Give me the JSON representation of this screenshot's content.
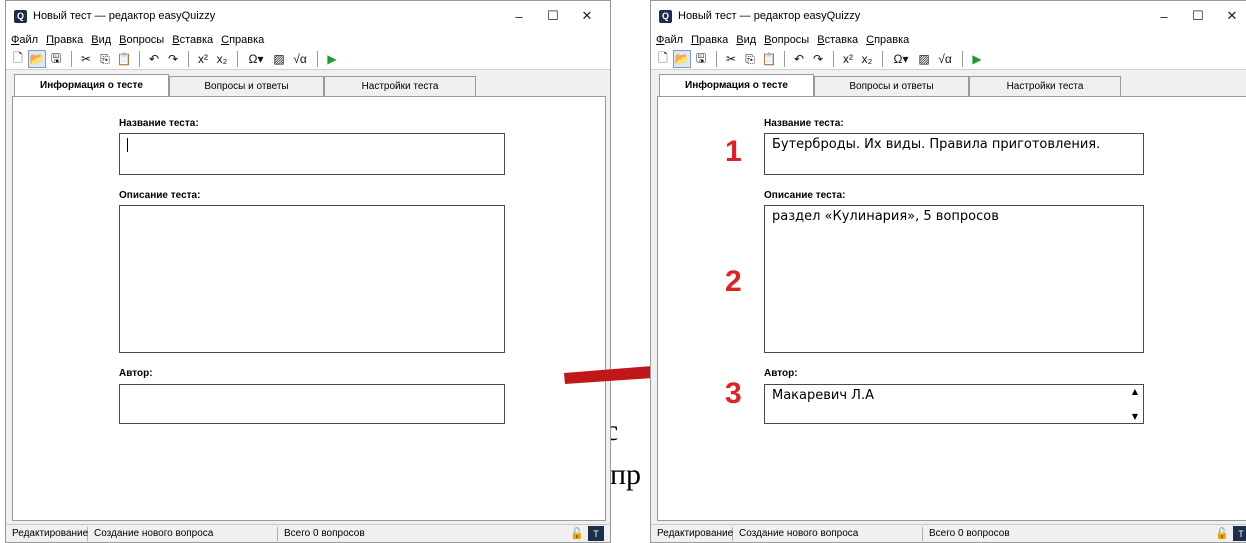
{
  "window": {
    "title": "Новый тест — редактор easyQuizzy",
    "icon_letter": "Q"
  },
  "window_controls": {
    "minimize": "–",
    "maximize": "☐",
    "close": "✕"
  },
  "menu": [
    "Файл",
    "Правка",
    "Вид",
    "Вопросы",
    "Вставка",
    "Справка"
  ],
  "toolbar_icons": [
    "new-icon",
    "open-icon",
    "save-icon",
    "cut-icon",
    "copy-icon",
    "paste-icon",
    "undo-icon",
    "redo-icon",
    "superscript-icon",
    "subscript-icon",
    "omega-icon",
    "image-icon",
    "formula-icon",
    "run-icon"
  ],
  "toolbar_glyphs": {
    "new": "🗋",
    "open": "📂",
    "save": "🖫",
    "cut": "✂",
    "copy": "⎘",
    "paste": "📋",
    "undo": "↶",
    "redo": "↷",
    "superscript": "x²",
    "subscript": "x₂",
    "omega": "Ω▾",
    "image": "▨",
    "formula": "√α",
    "run": "▶"
  },
  "tabs": [
    "Информация о тесте",
    "Вопросы и ответы",
    "Настройки теста"
  ],
  "form": {
    "name_label": "Название теста:",
    "description_label": "Описание теста:",
    "author_label": "Автор:"
  },
  "left_values": {
    "name": "",
    "description": "",
    "author": ""
  },
  "right_values": {
    "name": "Бутерброды. Их виды. Правила приготовления.",
    "description": "раздел «Кулинария», 5 вопросов",
    "author": "Макаревич Л.А"
  },
  "markers": [
    "1",
    "2",
    "3"
  ],
  "status": {
    "mode": "Редактирование",
    "action": "Создание нового вопроса",
    "count": "Всего 0 вопросов"
  },
  "background_text": {
    "line1": "а с",
    "line2": "опр"
  },
  "colors": {
    "marker": "#e12222",
    "arrow": "#c0171a",
    "run": "#1f9a2c"
  }
}
